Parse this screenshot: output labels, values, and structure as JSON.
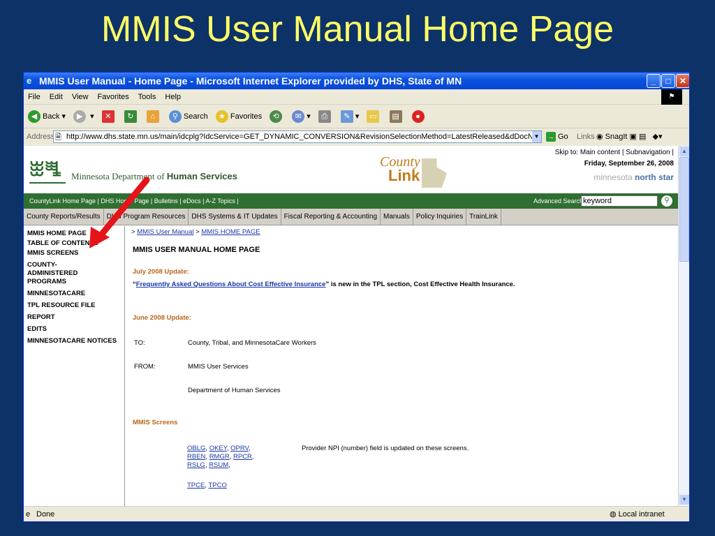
{
  "slide": {
    "title": "MMIS User Manual Home Page"
  },
  "window": {
    "title": "MMIS User Manual - Home Page - Microsoft Internet Explorer provided by DHS, State of MN"
  },
  "menu": [
    "File",
    "Edit",
    "View",
    "Favorites",
    "Tools",
    "Help"
  ],
  "toolbar": {
    "back": "Back",
    "search": "Search",
    "favorites": "Favorites"
  },
  "address": {
    "label": "Address",
    "url": "http://www.dhs.state.mn.us/main/idcplg?IdcService=GET_DYNAMIC_CONVERSION&RevisionSelectionMethod=LatestReleased&dDocName=user_manual",
    "go": "Go",
    "links": "Links",
    "snagit": "SnagIt"
  },
  "header": {
    "skip": "Skip to: Main content | Subnavigation |",
    "date": "Friday, September 26, 2008",
    "northstar_a": "minnesota",
    "northstar_b": "north star",
    "org_a": "Minnesota Department of",
    "org_b": "Human Services",
    "countylink_a": "County",
    "countylink_b": "Link"
  },
  "greenbar": {
    "links": "CountyLink Home Page | DHS Home Page | Bulletins | eDocs | A-Z Topics |",
    "advanced": "Advanced Search",
    "keyword": "keyword"
  },
  "tabs": [
    "County Reports/Results",
    "DHS Program Resources",
    "DHS Systems & IT Updates",
    "Fiscal Reporting & Accounting",
    "Manuals",
    "Policy Inquiries",
    "TrainLink"
  ],
  "leftnav": [
    "MMIS HOME PAGE",
    "TABLE OF CONTENTS",
    "MMIS SCREENS",
    "COUNTY-ADMINISTERED PROGRAMS",
    "MINNESOTACARE",
    "TPL RESOURCE FILE",
    "REPORT",
    "EDITS",
    "MINNESOTACARE NOTICES"
  ],
  "content": {
    "crumb_a": "MMIS User Manual",
    "crumb_b": "MMIS HOME PAGE",
    "heading": "MMIS USER MANUAL HOME PAGE",
    "july_update": "July 2008 Update:",
    "faq_link": "Frequently Asked Questions About Cost Effective Insurance",
    "faq_rest": "is new in the TPL section, Cost Effective Health Insurance.",
    "june_update": "June 2008 Update:",
    "to_label": "TO:",
    "to_value": "County, Tribal, and MinnesotaCare Workers",
    "from_label": "FROM:",
    "from_value": "MMIS User Services",
    "from_value2": "Department of Human Services",
    "screens_heading": "MMIS Screens",
    "screens_row1": [
      "OBLG",
      "OKEY",
      "OPRV"
    ],
    "screens_row2": [
      "RBEN",
      "RMGR",
      "RPCR"
    ],
    "screens_row3": [
      "RSLG",
      "RSUM"
    ],
    "screens_row4": [
      "TPCE",
      "TPCO"
    ],
    "screens_note": "Provider NPI (number) field is updated on these screens."
  },
  "status": {
    "left": "Done",
    "zone": "Local intranet"
  }
}
